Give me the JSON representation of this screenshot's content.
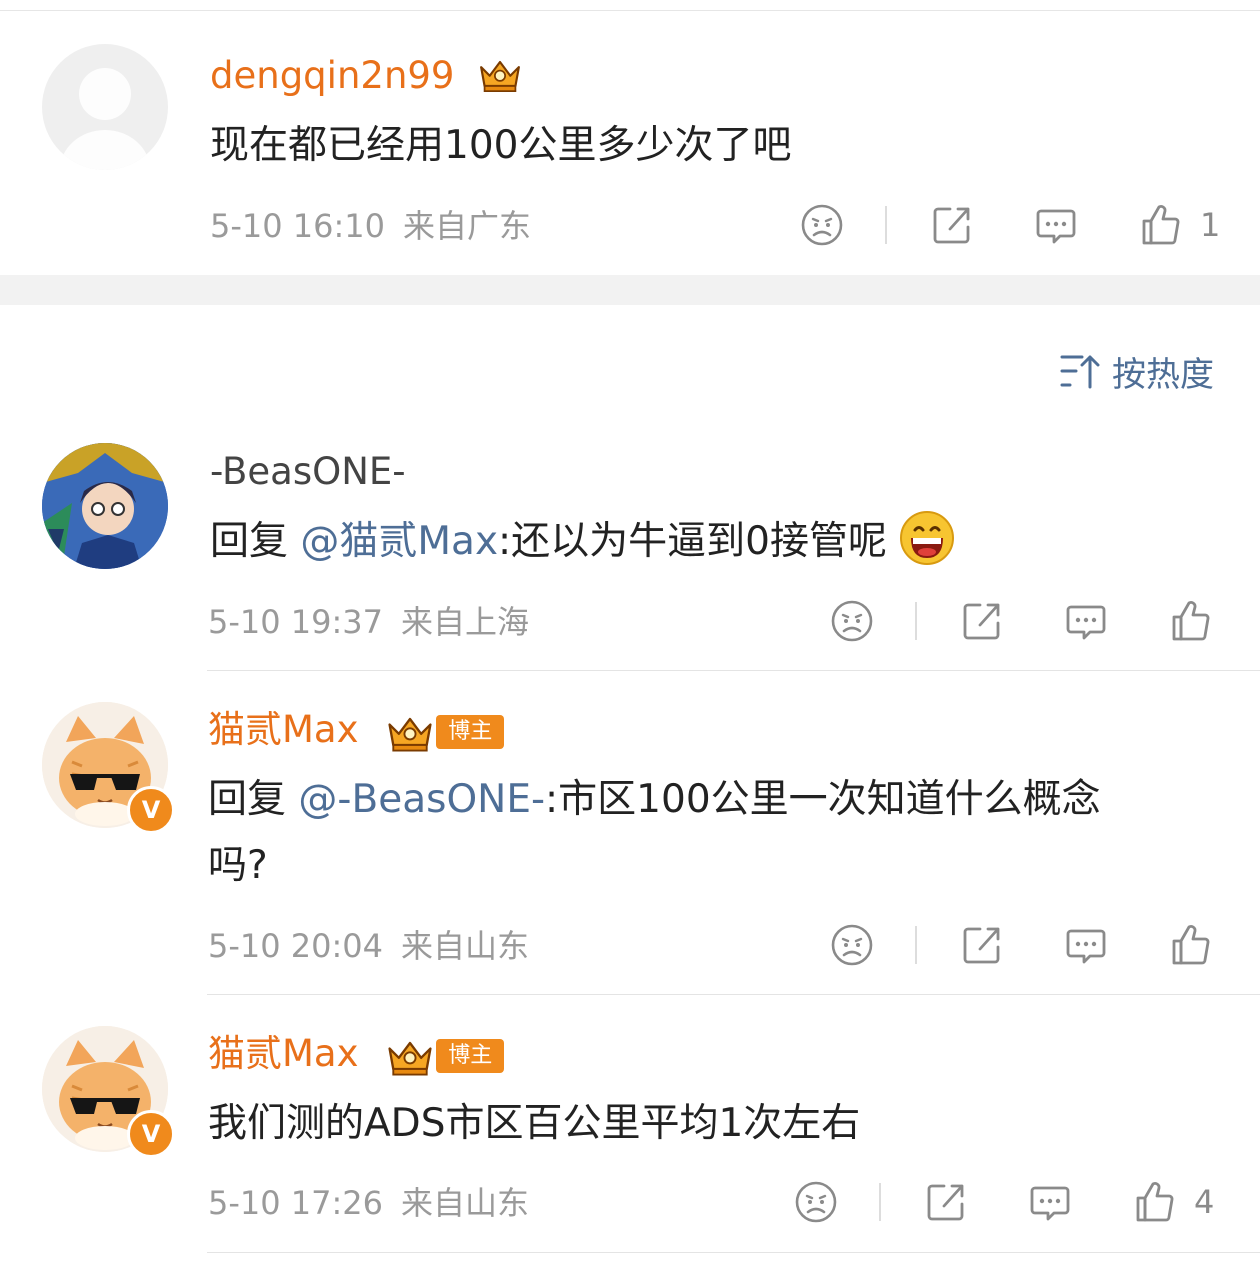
{
  "sort_label": "按热度",
  "top_comment": {
    "username": "dengqin2n99",
    "text": "现在都已经用100公里多少次了吧",
    "date": "5-10 16:10",
    "location": "来自广东",
    "like_count": "1"
  },
  "replies": [
    {
      "username": "-BeasONE-",
      "prefix": "回复 ",
      "mention": "@猫贰Max",
      "text": ":还以为牛逼到0接管呢",
      "date": "5-10 19:37",
      "location": "来自上海",
      "like_count": ""
    },
    {
      "username": "猫贰Max",
      "badge": "博主",
      "prefix": "回复 ",
      "mention": "@-BeasONE-",
      "text": ":市区100公里一次知道什么概念",
      "text_line2": "吗?",
      "date": "5-10 20:04",
      "location": "来自山东",
      "like_count": "",
      "verified_mark": "V"
    },
    {
      "username": "猫贰Max",
      "badge": "博主",
      "text": "我们测的ADS市区百公里平均1次左右",
      "date": "5-10 17:26",
      "location": "来自山东",
      "like_count": "4",
      "verified_mark": "V"
    }
  ],
  "icons": {
    "dislike": "sad-face-icon",
    "share": "share-icon",
    "comment": "comment-icon",
    "like": "thumbs-up-icon",
    "sort": "sort-icon",
    "vip": "crown-icon",
    "emoji": "grin-emoji-icon"
  },
  "colors": {
    "username_orange": "#e8701a",
    "mention_blue": "#4e6e96",
    "meta_gray": "#9a9a9a",
    "badge_orange": "#f08a1c"
  }
}
